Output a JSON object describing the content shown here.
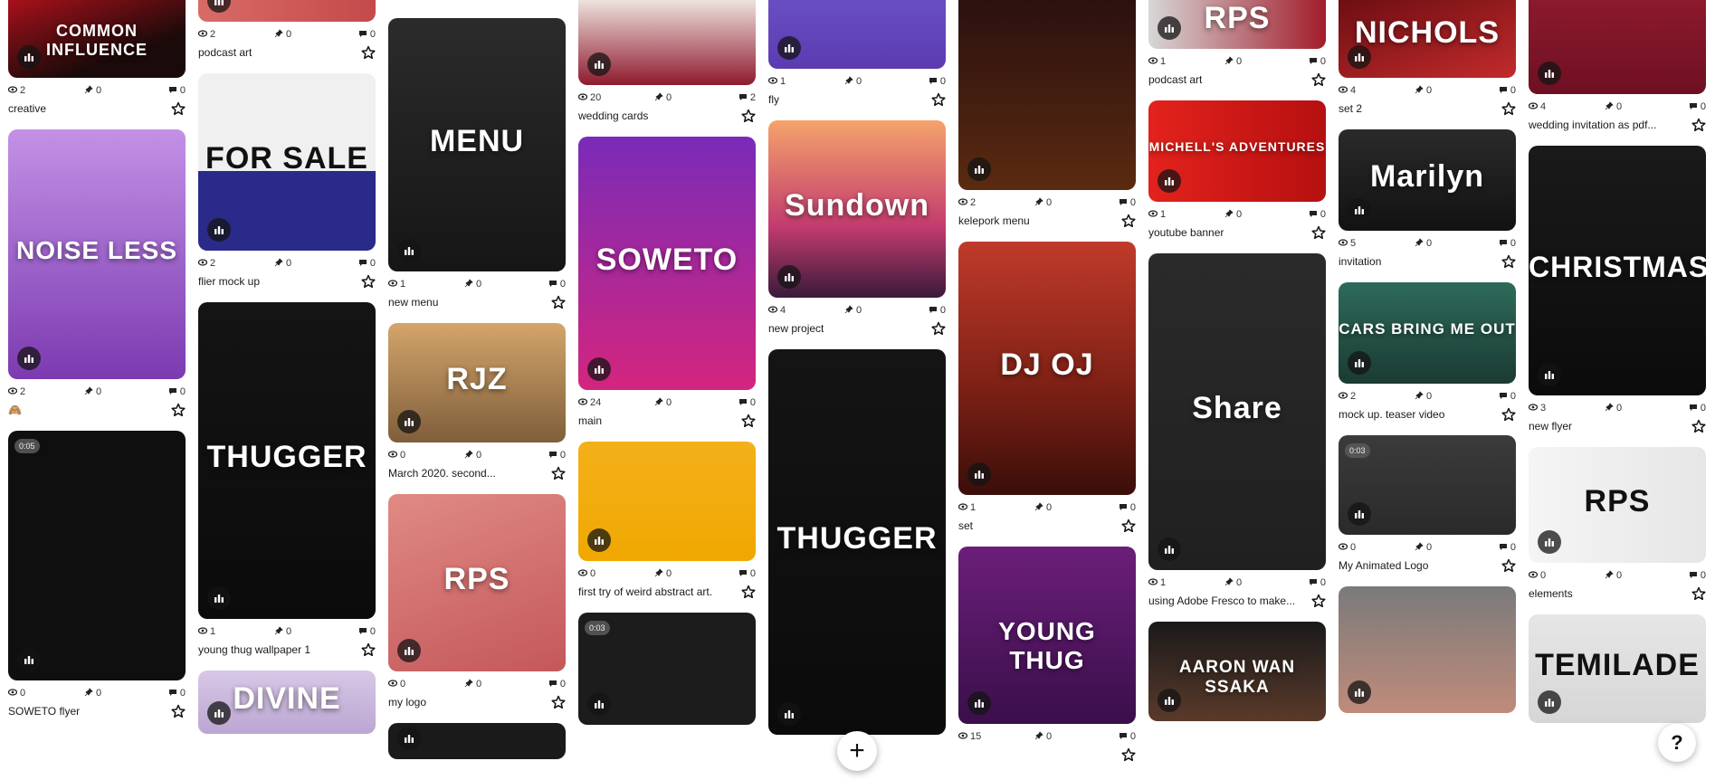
{
  "icons": {
    "views": "eye-icon",
    "appreciations": "pin-icon",
    "comments": "comment-icon",
    "favorite": "star-icon",
    "project": "stack-icon"
  },
  "columns": [
    [
      {
        "art": "COMMON INFLUENCE",
        "h": 94,
        "cut": true,
        "bg": "linear-gradient(160deg,#b3111c,#1b0a0a 70%)",
        "title": "creative",
        "views": "2",
        "pins": "0",
        "comments": "0"
      },
      {
        "art": "NOISE LESS",
        "h": 276,
        "bg": "linear-gradient(180deg,#c391e6,#7c3ab0)",
        "title": "🙈",
        "views": "2",
        "pins": "0",
        "comments": "0"
      },
      {
        "art": "",
        "h": 276,
        "bg": "#0f0f0f",
        "duration": "0:05",
        "title": "SOWETO flyer",
        "views": "0",
        "pins": "0",
        "comments": "0"
      }
    ],
    [
      {
        "art": "",
        "h": 28,
        "cut": true,
        "bg": "linear-gradient(90deg,#d96b66,#c44a4a)",
        "title": "podcast art",
        "views": "2",
        "pins": "0",
        "comments": "0"
      },
      {
        "art": "FOR SALE",
        "h": 196,
        "bg": "linear-gradient(180deg,#f0f0f0 55%,#2a2a8a 55%)",
        "dark": true,
        "title": "flier mock up",
        "views": "2",
        "pins": "0",
        "comments": "0"
      },
      {
        "art": "THUGGER",
        "h": 350,
        "bg": "linear-gradient(180deg,#141414,#0b0b0b)",
        "title": "young thug wallpaper 1",
        "views": "1",
        "pins": "0",
        "comments": "0"
      },
      {
        "art": "DIVINE",
        "h": 70,
        "bg": "linear-gradient(180deg,#d8c8e6,#bba6d2)",
        "title": "",
        "views": "",
        "pins": "",
        "comments": ""
      }
    ],
    [
      {
        "art": "MENU",
        "h": 280,
        "bg": "linear-gradient(180deg,#2b2b2b,#161616)",
        "title": "new menu",
        "views": "1",
        "pins": "0",
        "comments": "0"
      },
      {
        "art": "RJZ",
        "h": 132,
        "bg": "linear-gradient(180deg,#d4a56b,#7f5e3b)",
        "title": "March 2020. second...",
        "views": "0",
        "pins": "0",
        "comments": "0"
      },
      {
        "art": "RPS",
        "h": 196,
        "bg": "linear-gradient(160deg,#e08a84,#c4585a)",
        "title": "my logo",
        "views": "0",
        "pins": "0",
        "comments": "0"
      },
      {
        "art": "",
        "h": 40,
        "bg": "#1a1a1a",
        "title": "",
        "views": "",
        "pins": "",
        "comments": ""
      }
    ],
    [
      {
        "art": "",
        "h": 100,
        "cut": true,
        "bg": "linear-gradient(180deg,#f4efe8,#8e1a2e)",
        "title": "wedding cards",
        "views": "20",
        "pins": "0",
        "comments": "2"
      },
      {
        "art": "SOWETO",
        "h": 280,
        "bg": "linear-gradient(180deg,#7a2bb8,#d4257e)",
        "title": "main",
        "views": "24",
        "pins": "0",
        "comments": "0"
      },
      {
        "art": "",
        "h": 132,
        "bg": "linear-gradient(180deg,#f3b01a,#f0a800)",
        "title": "first try of weird abstract art.",
        "views": "0",
        "pins": "0",
        "comments": "0"
      },
      {
        "art": "",
        "h": 124,
        "bg": "#1c1c1c",
        "duration": "0:03",
        "title": "",
        "views": "",
        "pins": "",
        "comments": ""
      }
    ],
    [
      {
        "art": "",
        "h": 82,
        "cut": true,
        "bg": "linear-gradient(180deg,#6a4fc4,#5b3cb0)",
        "title": "fly",
        "views": "1",
        "pins": "0",
        "comments": "0"
      },
      {
        "art": "Sundown",
        "h": 196,
        "bg": "linear-gradient(180deg,#f5a36b,#c23b6e 60%,#3a1a3a)",
        "title": "new project",
        "views": "4",
        "pins": "0",
        "comments": "0"
      },
      {
        "art": "THUGGER",
        "h": 426,
        "bg": "linear-gradient(180deg,#141414,#0b0b0b)",
        "title": "",
        "views": "",
        "pins": "",
        "comments": ""
      }
    ],
    [
      {
        "art": "",
        "h": 216,
        "cut": true,
        "bg": "linear-gradient(180deg,#2a1010,#5a2a10)",
        "title": "kelepork menu",
        "views": "2",
        "pins": "0",
        "comments": "0"
      },
      {
        "art": "DJ OJ",
        "h": 280,
        "bg": "linear-gradient(180deg,#c03a2a,#7a1f14 60%,#3a0e0a)",
        "title": "set",
        "views": "1",
        "pins": "0",
        "comments": "0"
      },
      {
        "art": "YOUNG THUG",
        "h": 196,
        "bg": "linear-gradient(180deg,#6b1e7a,#3a0f4a)",
        "title": "",
        "views": "15",
        "pins": "0",
        "comments": "0"
      }
    ],
    [
      {
        "art": "RPS",
        "h": 60,
        "cut": true,
        "bg": "linear-gradient(90deg,#d7d7d7,#a21c2a)",
        "title": "podcast art",
        "views": "1",
        "pins": "0",
        "comments": "0"
      },
      {
        "art": "MICHELL'S ADVENTURES",
        "h": 112,
        "bg": "linear-gradient(90deg,#e3221c,#b51010)",
        "title": "youtube banner",
        "views": "1",
        "pins": "0",
        "comments": "0"
      },
      {
        "art": "Share",
        "h": 350,
        "bg": "linear-gradient(180deg,#2a2a2a,#202020)",
        "title": "using Adobe Fresco to make...",
        "views": "1",
        "pins": "0",
        "comments": "0"
      },
      {
        "art": "AARON WAN SSAKA",
        "h": 110,
        "bg": "linear-gradient(180deg,#1a1a1a,#5a3a2a)",
        "title": "",
        "views": "",
        "pins": "",
        "comments": ""
      }
    ],
    [
      {
        "art": "NICHOLS",
        "h": 92,
        "cut": true,
        "bg": "linear-gradient(160deg,#6a0d12,#c22b2b)",
        "title": "set 2",
        "views": "4",
        "pins": "0",
        "comments": "0"
      },
      {
        "art": "Marilyn",
        "h": 112,
        "bg": "linear-gradient(180deg,#2a2a2a,#121212)",
        "title": "invitation",
        "views": "5",
        "pins": "0",
        "comments": "0"
      },
      {
        "art": "CARS BRING ME OUT",
        "h": 112,
        "bg": "linear-gradient(180deg,#2d6b5a,#1b3a33)",
        "title": "mock up. teaser video",
        "views": "2",
        "pins": "0",
        "comments": "0"
      },
      {
        "art": "",
        "h": 110,
        "bg": "linear-gradient(180deg,#3b3b3b,#2a2a2a)",
        "duration": "0:03",
        "title": "My Animated Logo",
        "views": "0",
        "pins": "0",
        "comments": "0"
      },
      {
        "art": "",
        "h": 140,
        "bg": "linear-gradient(180deg,#7a7a7a,#c08b7a)",
        "title": "",
        "views": "",
        "pins": "",
        "comments": ""
      }
    ],
    [
      {
        "art": "",
        "h": 110,
        "cut": true,
        "bg": "linear-gradient(180deg,#8e1a2e,#6e1022)",
        "title": "wedding invitation as pdf...",
        "views": "4",
        "pins": "0",
        "comments": "0"
      },
      {
        "art": "CHRISTMAS",
        "h": 276,
        "bg": "linear-gradient(180deg,#1a1a1a,#0b0b0b)",
        "title": "new flyer",
        "views": "3",
        "pins": "0",
        "comments": "0"
      },
      {
        "art": "RPS",
        "h": 128,
        "bg": "linear-gradient(90deg,#f5f5f5,#e6e6e6)",
        "dark": true,
        "title": "elements",
        "views": "0",
        "pins": "0",
        "comments": "0"
      },
      {
        "art": "TEMILADE",
        "h": 120,
        "bg": "linear-gradient(180deg,#e6e6e6,#d6d6d6)",
        "dark": true,
        "title": "",
        "views": "",
        "pins": "",
        "comments": ""
      }
    ]
  ],
  "fab": {
    "plus": "+",
    "help": "?"
  }
}
